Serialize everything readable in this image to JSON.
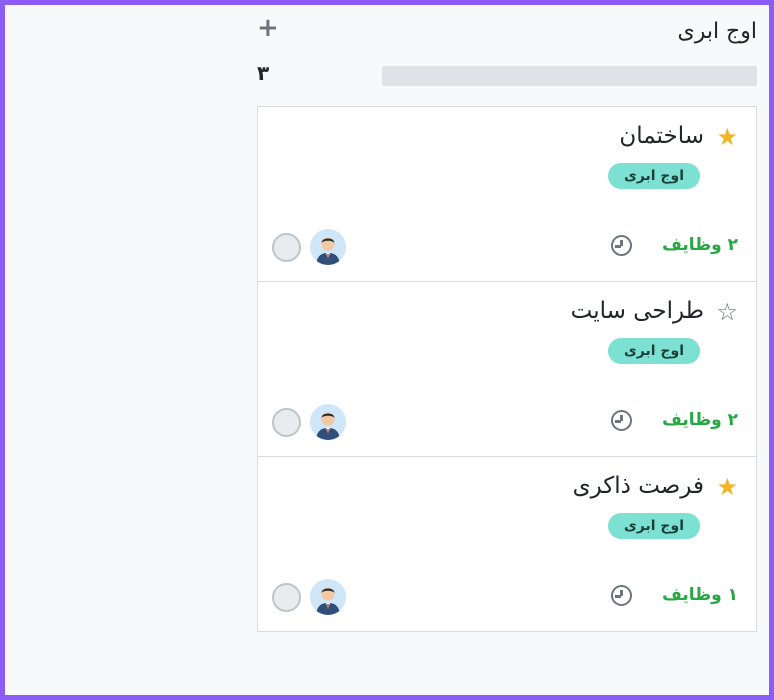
{
  "column": {
    "title": "اوج ابری",
    "add_symbol": "+",
    "count": "۳"
  },
  "cards": [
    {
      "name": "ساختمان",
      "favorite": true,
      "star_on": "★",
      "tag": "اوج ابری",
      "tasks": "۲ وظایف"
    },
    {
      "name": "طراحی سایت",
      "favorite": false,
      "star_off": "☆",
      "tag": "اوج ابری",
      "tasks": "۲ وظایف"
    },
    {
      "name": "فرصت ذاکری",
      "favorite": true,
      "star_on": "★",
      "tag": "اوج ابری",
      "tasks": "۱ وظایف"
    }
  ],
  "colors": {
    "frame": "#8b5cf6",
    "star": "#f3b528",
    "tag": "#7ce0d3",
    "tasks": "#28a745"
  },
  "icons": [
    "plus-icon",
    "star-icon",
    "clock-icon",
    "user-avatar-icon",
    "circle-icon"
  ]
}
